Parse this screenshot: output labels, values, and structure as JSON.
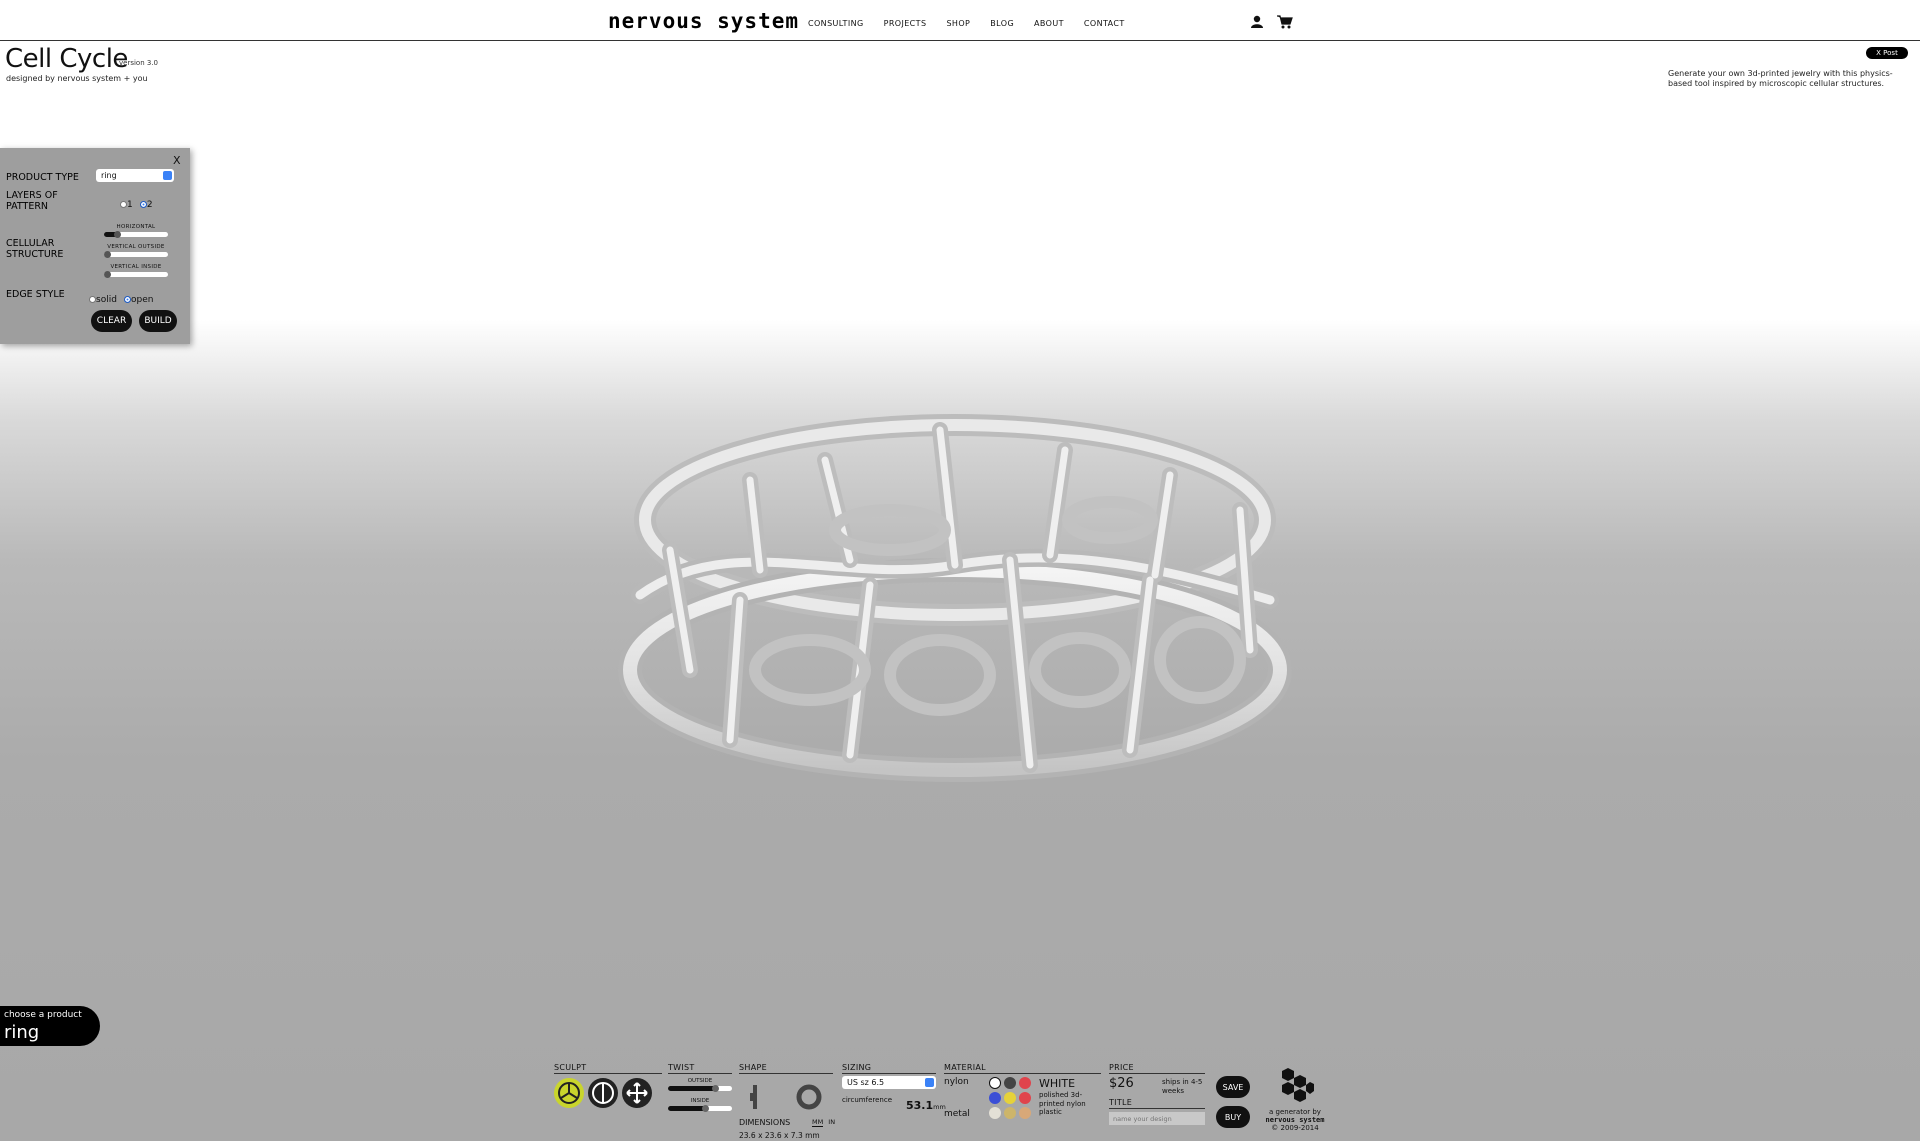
{
  "header": {
    "logo": "nervous system",
    "nav": [
      "CONSULTING",
      "PROJECTS",
      "SHOP",
      "BLOG",
      "ABOUT",
      "CONTACT"
    ],
    "icons": [
      "user-icon",
      "cart-icon"
    ],
    "xpost": "X Post"
  },
  "app": {
    "title": "Cell Cycle",
    "version": "version 3.0",
    "byline": "designed by nervous system + you",
    "description": "Generate your own 3d-printed jewelry with this physics-based tool inspired by microscopic cellular structures."
  },
  "panel": {
    "close": "X",
    "product_type_label": "PRODUCT TYPE",
    "product_type_value": "ring",
    "layers_label": "LAYERS OF PATTERN",
    "layers_options": [
      "1",
      "2"
    ],
    "layers_selected": "2",
    "cellular_label": "CELLULAR STRUCTURE",
    "sliders": [
      {
        "label": "HORIZONTAL",
        "value": 0.2
      },
      {
        "label": "VERTICAL OUTSIDE",
        "value": 0.02
      },
      {
        "label": "VERTICAL INSIDE",
        "value": 0.02
      }
    ],
    "edge_label": "EDGE STYLE",
    "edge_options": [
      "solid",
      "open"
    ],
    "edge_selected": "open",
    "clear": "CLEAR",
    "build": "BUILD"
  },
  "product_chooser": {
    "label": "choose a product",
    "value": "ring"
  },
  "toolbar": {
    "sculpt": {
      "title": "SCULPT",
      "tools": [
        "sculpt-icon",
        "pinch-icon",
        "move-icon"
      ],
      "active": 0
    },
    "twist": {
      "title": "TWIST",
      "outside_label": "OUTSIDE",
      "outside_value": 0.75,
      "inside_label": "INSIDE",
      "inside_value": 0.6
    },
    "shape": {
      "title": "SHAPE",
      "dimensions_label": "DIMENSIONS",
      "unit_mm": "MM",
      "unit_in": "IN",
      "dimensions": "23.6 x 23.6 x 7.3 mm"
    },
    "sizing": {
      "title": "SIZING",
      "size": "US sz 6.5",
      "circumference_label": "circumference",
      "circumference_value": "53.1",
      "circumference_unit": "mm"
    },
    "material": {
      "title": "MATERIAL",
      "nylon_label": "nylon",
      "metal_label": "metal",
      "selected_name": "WHITE",
      "selected_desc": "polished 3d-printed nylon plastic",
      "nylon_colors": [
        "#ffffff",
        "#444444",
        "#e0444c",
        "#3b4fd6",
        "#e6d23a",
        "#e0444c"
      ],
      "metal_colors": [
        "#e3e0d6",
        "#cdb56a",
        "#d8a878"
      ]
    },
    "price": {
      "title": "PRICE",
      "value": "$26",
      "ships": "ships in 4-5 weeks",
      "title_label": "TITLE",
      "name_placeholder": "name your design"
    },
    "save": "SAVE",
    "buy": "BUY",
    "credit": {
      "line1": "a generator by",
      "line2": "nervous system",
      "line3": "© 2009-2014"
    }
  }
}
